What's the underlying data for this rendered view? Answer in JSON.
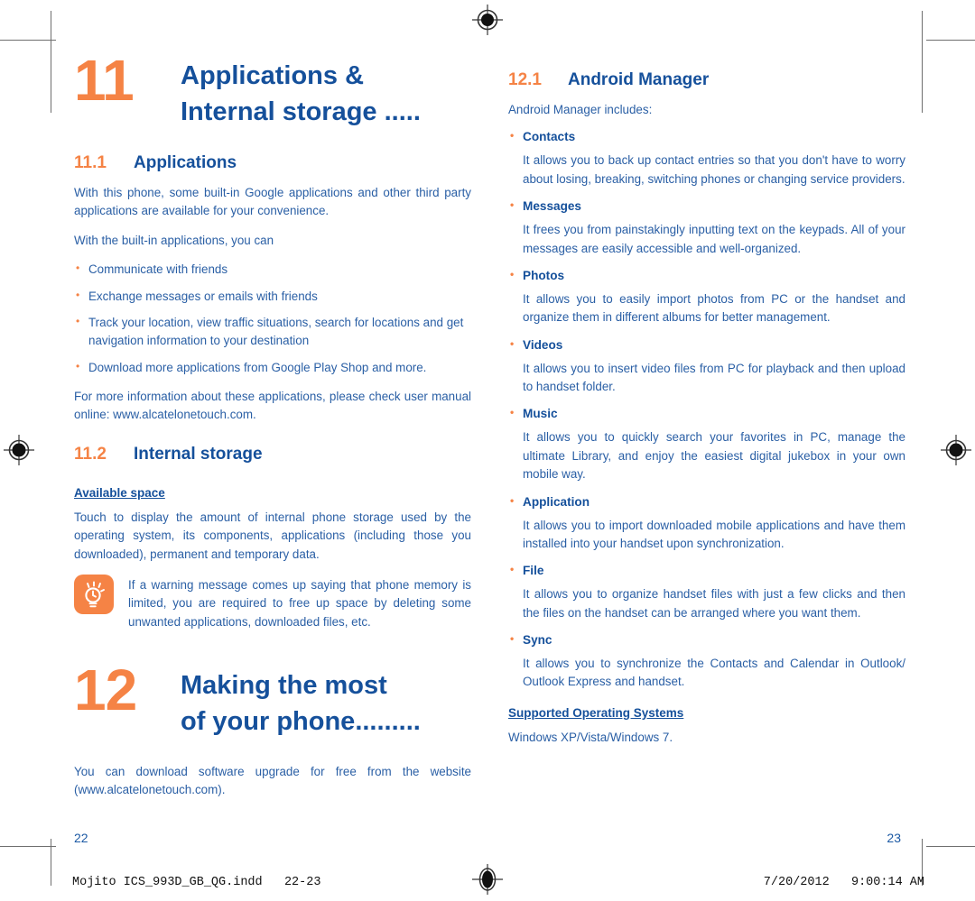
{
  "document": {
    "slug_left": "Mojito ICS_993D_GB_QG.indd   22-23",
    "slug_right": "7/20/2012   9:00:14 AM"
  },
  "left_page": {
    "folio": "22",
    "chapter": {
      "number": "11",
      "title_line1": "Applications &",
      "title_line2": "Internal storage ....."
    },
    "section_applications": {
      "number": "11.1",
      "name": "Applications",
      "intro": "With this phone, some built-in Google applications and other third party applications are available for your convenience.",
      "lead_in": "With the built-in applications, you can",
      "bullets": [
        "Communicate with friends",
        "Exchange messages or emails with friends",
        "Track your location, view traffic situations, search for locations and get navigation information to your destination",
        "Download more applications from Google Play Shop and more."
      ],
      "outro": "For more information about these applications, please check user manual  online: www.alcatelonetouch.com."
    },
    "section_storage": {
      "number": "11.2",
      "name": "Internal storage",
      "sub_head": "Available space ",
      "body": "Touch to display the amount of internal phone storage used by the operating system, its components, applications (including those you downloaded), permanent and temporary data.",
      "tip_icon": "lightbulb-icon",
      "tip_text": "If a warning message comes up saying that phone memory is limited, you are required to free up space by deleting some unwanted applications, downloaded files, etc."
    },
    "chapter12": {
      "number": "12",
      "title_line1": "Making the most",
      "title_line2": "of your phone........."
    },
    "chapter12_body": "You can download software upgrade for free from the website (www.alcatelonetouch.com)."
  },
  "right_page": {
    "folio": "23",
    "section": {
      "number": "12.1",
      "name": "Android Manager",
      "intro": "Android Manager includes:"
    },
    "features": [
      {
        "term": "Contacts",
        "desc": "It allows you to back up contact entries so that you don't have to worry about losing, breaking, switching phones or changing service providers."
      },
      {
        "term": "Messages",
        "desc": "It frees you from painstakingly inputting text on the keypads. All of your messages are easily accessible and well-organized."
      },
      {
        "term": "Photos",
        "desc": "It allows you to easily import photos from PC or the handset and organize them in different albums for better management."
      },
      {
        "term": "Videos",
        "desc": "It allows you to insert video files from PC for playback and then upload to handset folder."
      },
      {
        "term": "Music",
        "desc": "It allows you to quickly search your favorites in PC, manage the ultimate Library, and enjoy the easiest digital jukebox in your own mobile way."
      },
      {
        "term": "Application",
        "desc": "It allows you to import downloaded mobile applications and have them installed into your handset upon synchronization."
      },
      {
        "term": "File",
        "desc": "It allows you to organize handset files with just a few clicks and then the files on the handset can be arranged where you want them."
      },
      {
        "term": "Sync",
        "desc": "It allows you to synchronize the Contacts and Calendar in Outlook/ Outlook Express and handset."
      }
    ],
    "os_head": "Supported Operating Systems",
    "os_text": "Windows XP/Vista/Windows 7."
  },
  "colors": {
    "accent_orange": "#F58345",
    "heading_blue": "#15509B",
    "body_blue": "#2A5FA5",
    "crop_gray": "#6E6E6E"
  }
}
